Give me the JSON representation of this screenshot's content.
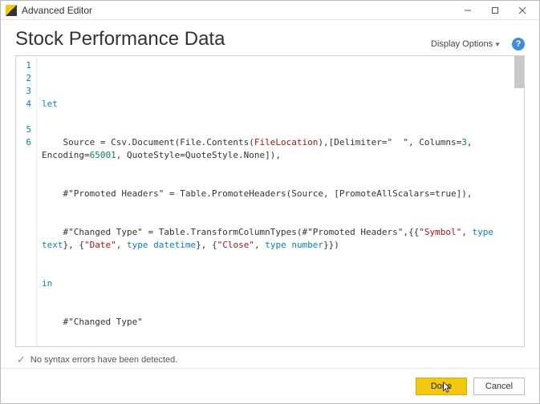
{
  "window": {
    "title": "Advanced Editor"
  },
  "header": {
    "page_title": "Stock Performance Data",
    "display_options_label": "Display Options",
    "help_tooltip": "?"
  },
  "editor": {
    "line_numbers": [
      "1",
      "2",
      "3",
      "4",
      "5",
      "6"
    ],
    "code": {
      "l1_let": "let",
      "l2_indent": "    Source = Csv.Document(File.Contents(",
      "l2_fileloc": "FileLocation",
      "l2_mid": "),[Delimiter=\"  \", Columns=",
      "l2_cols": "3",
      "l2_enc": ", Encoding=",
      "l2_encval": "65001",
      "l2_tail": ", QuoteStyle=QuoteStyle.None]),",
      "l3": "    #\"Promoted Headers\" = Table.PromoteHeaders(Source, [PromoteAllScalars=true]),",
      "l4_a": "    #\"Changed Type\" = Table.TransformColumnTypes(#\"Promoted Headers\",{{",
      "l4_sym": "\"Symbol\"",
      "l4_b": ", ",
      "l4_tt": "type text",
      "l4_c": "}, {",
      "l4_date": "\"Date\"",
      "l4_d": ", ",
      "l4_td": "type datetime",
      "l4_e": "}, {",
      "l4_close": "\"Close\"",
      "l4_f": ", ",
      "l4_tn": "type number",
      "l4_g": "}})",
      "l5_in": "in",
      "l6": "    #\"Changed Type\""
    }
  },
  "status": {
    "message": "No syntax errors have been detected."
  },
  "footer": {
    "done_label": "Done",
    "cancel_label": "Cancel"
  }
}
